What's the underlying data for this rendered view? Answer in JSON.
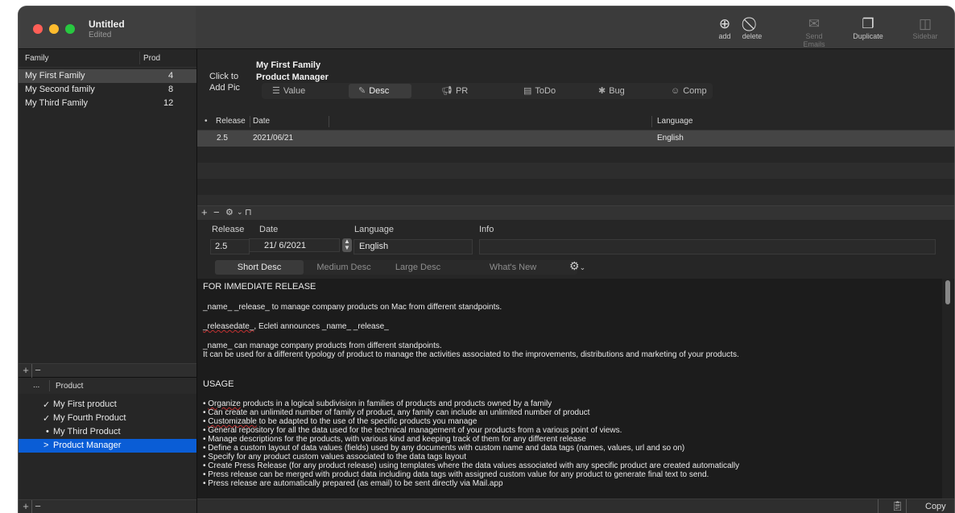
{
  "window": {
    "title": "Untitled",
    "subtitle": "Edited"
  },
  "toolbar": {
    "add": "add",
    "delete": "delete",
    "send_emails": "Send Emails",
    "duplicate": "Duplicate",
    "sidebar": "Sidebar"
  },
  "families": {
    "col_family": "Family",
    "col_prod": "Prod",
    "items": [
      {
        "name": "My First Family",
        "count": "4"
      },
      {
        "name": "My Second family",
        "count": "8"
      },
      {
        "name": "My Third Family",
        "count": "12"
      }
    ]
  },
  "products": {
    "col_marker": "...",
    "col_product": "Product",
    "items": [
      {
        "marker": "✓",
        "name": "My First product"
      },
      {
        "marker": "✓",
        "name": "My Fourth Product"
      },
      {
        "marker": "•",
        "name": "My Third Product"
      },
      {
        "marker": ">",
        "name": "Product Manager"
      }
    ]
  },
  "header": {
    "click_to_add_pic_1": "Click to",
    "click_to_add_pic_2": "Add Pic",
    "family_name": "My First Family",
    "product_name": "Product Manager"
  },
  "tabs": [
    {
      "label": "Value",
      "icon": "list-icon"
    },
    {
      "label": "Desc",
      "icon": "pencil-icon"
    },
    {
      "label": "PR",
      "icon": "megaphone-icon"
    },
    {
      "label": "ToDo",
      "icon": "todo-icon"
    },
    {
      "label": "Bug",
      "icon": "bug-icon"
    },
    {
      "label": "Comp",
      "icon": "people-icon"
    }
  ],
  "releases_table": {
    "col_marker": "•",
    "col_release": "Release",
    "col_date": "Date",
    "col_language": "Language",
    "rows": [
      {
        "release": "2.5",
        "date": "2021/06/21",
        "language": "English"
      }
    ]
  },
  "detail": {
    "release_label": "Release",
    "date_label": "Date",
    "language_label": "Language",
    "info_label": "Info",
    "release_value": "2.5",
    "date_value": "21/ 6/2021",
    "language_value": "English",
    "info_value": ""
  },
  "desc_tabs": [
    "Short Desc",
    "Medium Desc",
    "Large Desc",
    "What's New"
  ],
  "text": {
    "l1": "FOR IMMEDIATE RELEASE",
    "l2": "_name_ _release_ to manage company products on Mac from different standpoints.",
    "l3a": "_releasedate_",
    "l3b": ", Ecleti announces _name_ _release_",
    "l4": "_name_ can manage company products from different standpoints.",
    "l5": "It can be used for a different typology of product to manage the activities associated to the improvements, distributions and marketing of your products.",
    "l6": "USAGE",
    "b1a": "• ",
    "b1b": "Organize",
    "b1c": " products in a logical subdivision in families of products and products owned by a family",
    "b2": "• Can create an unlimited number of family of product, any family can include an unlimited number of product",
    "b3a": "• ",
    "b3b": "Customizable",
    "b3c": " to be adapted to the use of the specific products you manage",
    "b4": "• General repository for all the data used for the technical management of your products from a various point of views.",
    "b5": "• Manage descriptions for the products, with various kind and keeping track of them for any different release",
    "b6": "• Define a custom layout of data values (fields) used by any documents with custom name and data tags (names, values, url and so on)",
    "b7": "• Specify for any product custom values associated to the data tags layout",
    "b8": "• Create Press Release (for any product release) using templates where the data values associated with any specific product are created automatically",
    "b9": "• Press release can be merged with product data including data tags with assigned custom value for any product to generate final text to send.",
    "b10": "• Press release are automatically prepared (as email) to be sent directly via Mail.app"
  },
  "footer": {
    "copy": "Copy"
  }
}
